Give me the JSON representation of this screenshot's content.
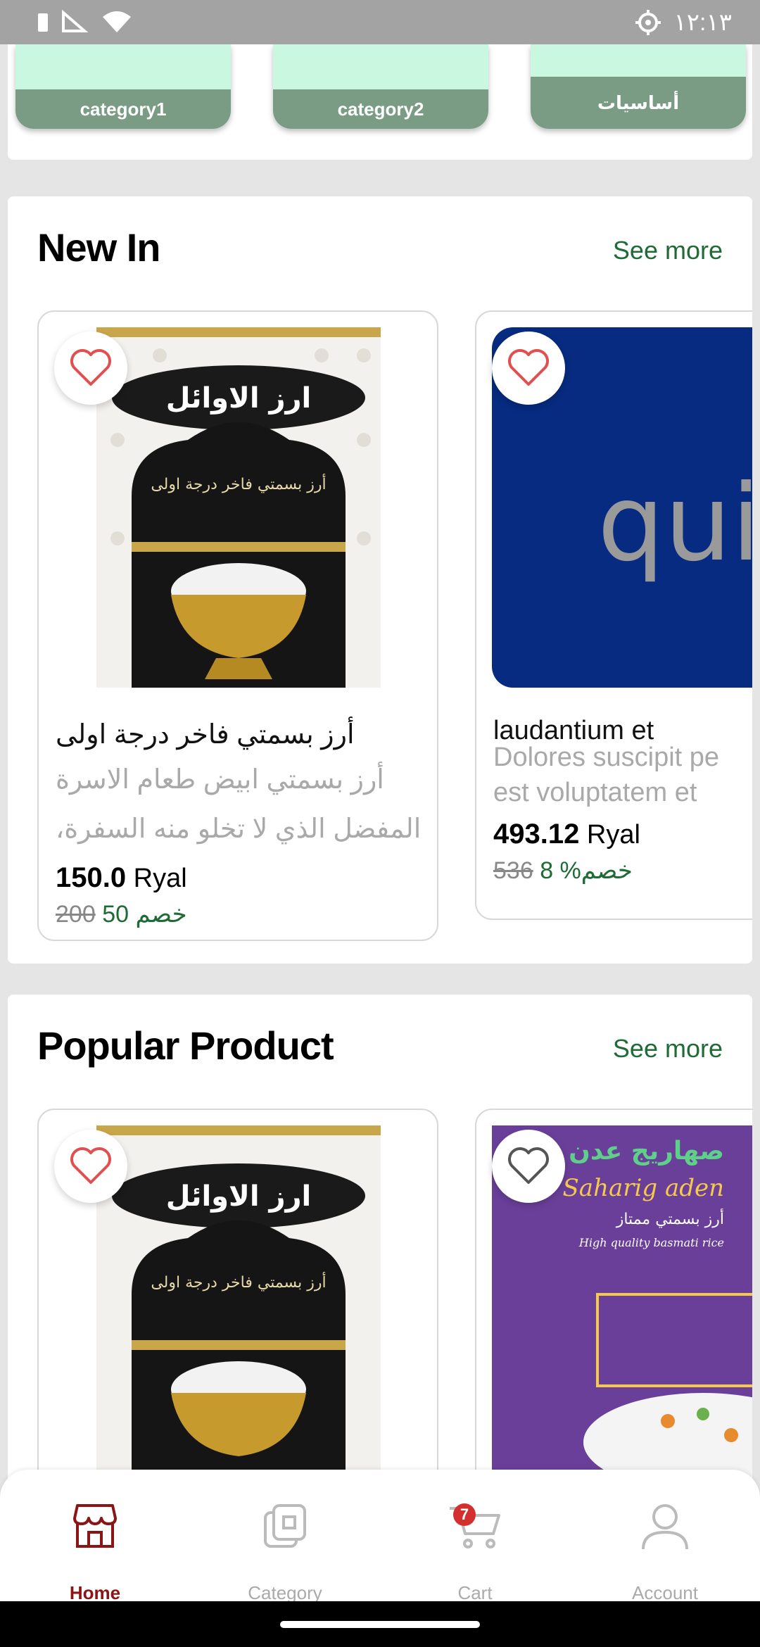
{
  "status_bar": {
    "time": "١٢:١٣"
  },
  "categories": [
    {
      "label": "category1"
    },
    {
      "label": "category2"
    },
    {
      "label": "أساسيات"
    }
  ],
  "new_in": {
    "title": "New In",
    "see_more": "See more",
    "products": [
      {
        "name": "أرز بسمتي فاخر درجة اولى",
        "desc_line1": "أرز بسمتي ابيض طعام الاسرة",
        "desc_line2": "المفضل الذي لا تخلو منه السفرة،",
        "price": "150.0",
        "currency": "Ryal",
        "old_price": "200",
        "discount": "خصم 50"
      },
      {
        "name": "laudantium et",
        "desc_line1": "Dolores suscipit pe",
        "desc_line2": "est voluptatem et",
        "price": "493.12",
        "currency": "Ryal",
        "old_price": "536",
        "discount": "خصم% 8",
        "image_text": "qui"
      }
    ]
  },
  "popular": {
    "title": "Popular Product",
    "see_more": "See more",
    "products": [
      {
        "image": "rice-bag-awael"
      },
      {
        "image": "rice-bag-saharig",
        "image_text_1": "صهاريج عدن",
        "image_text_2": "Saharig aden",
        "image_text_3": "أرز بسمتي ممتاز",
        "image_text_4": "High quality basmati rice"
      }
    ]
  },
  "rice_bag_text": {
    "brand": "ارز الاوائل",
    "sub": "أرز بسمتي فاخر درجة اولى"
  },
  "bottom_nav": {
    "items": [
      {
        "label": "Home"
      },
      {
        "label": "Category"
      },
      {
        "label": "Cart",
        "badge": "7"
      },
      {
        "label": "Account"
      }
    ]
  },
  "colors": {
    "accent": "#1e6b36",
    "active_nav": "#8b1515",
    "heart": "#e05050"
  }
}
